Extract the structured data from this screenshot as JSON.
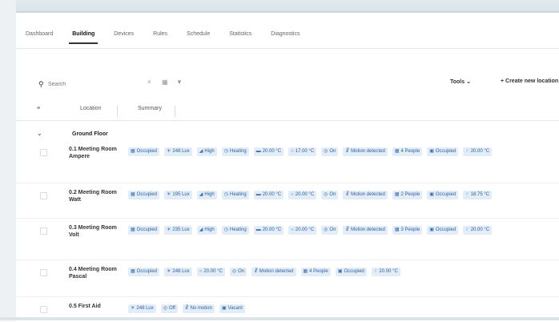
{
  "tabs": [
    "Dashboard",
    "Building",
    "Devices",
    "Rules",
    "Schedule",
    "Statistics",
    "Diagnostics"
  ],
  "active_tab": "Building",
  "toolbar": {
    "search_placeholder": "Search",
    "clear_icon": "close-icon",
    "view_icon": "grid-icon",
    "filter_icon": "filter-icon",
    "tools_label": "Tools ⌄",
    "create_label": "+ Create new location"
  },
  "table": {
    "headers": [
      "Location",
      "Summary"
    ],
    "group_label": "Ground Floor",
    "rows": [
      {
        "name": "0.1 Meeting Room Ampere",
        "chips": [
          {
            "icon": "people-icon",
            "text": "Occupied"
          },
          {
            "icon": "sun-icon",
            "text": "248 Lux"
          },
          {
            "icon": "signal-icon",
            "text": "High"
          },
          {
            "icon": "clock-icon",
            "text": "Heating"
          },
          {
            "icon": "thermo-icon",
            "text": "20.00 °C"
          },
          {
            "icon": "drop-icon",
            "text": "17.00 °C"
          },
          {
            "icon": "power-icon",
            "text": "On"
          },
          {
            "icon": "person-icon",
            "text": "Motion detected"
          },
          {
            "icon": "people-icon",
            "text": "4 People"
          },
          {
            "icon": "door-icon",
            "text": "Occupied"
          },
          {
            "icon": "temp-icon",
            "text": "20.00 °C"
          }
        ]
      },
      {
        "name": "0.2 Meeting Room Watt",
        "chips": [
          {
            "icon": "people-icon",
            "text": "Occupied"
          },
          {
            "icon": "sun-icon",
            "text": "195 Lux"
          },
          {
            "icon": "signal-icon",
            "text": "High"
          },
          {
            "icon": "clock-icon",
            "text": "Heating"
          },
          {
            "icon": "thermo-icon",
            "text": "20.00 °C"
          },
          {
            "icon": "drop-icon",
            "text": "20.00 °C"
          },
          {
            "icon": "power-icon",
            "text": "On"
          },
          {
            "icon": "person-icon",
            "text": "Motion detected"
          },
          {
            "icon": "people-icon",
            "text": "2 People"
          },
          {
            "icon": "door-icon",
            "text": "Occupied"
          },
          {
            "icon": "temp-icon",
            "text": "18.75 °C"
          }
        ]
      },
      {
        "name": "0.3 Meeting Room Volt",
        "chips": [
          {
            "icon": "people-icon",
            "text": "Occupied"
          },
          {
            "icon": "sun-icon",
            "text": "235 Lux"
          },
          {
            "icon": "signal-icon",
            "text": "High"
          },
          {
            "icon": "clock-icon",
            "text": "Heating"
          },
          {
            "icon": "thermo-icon",
            "text": "20.00 °C"
          },
          {
            "icon": "drop-icon",
            "text": "20.00 °C"
          },
          {
            "icon": "power-icon",
            "text": "On"
          },
          {
            "icon": "person-icon",
            "text": "Motion detected"
          },
          {
            "icon": "people-icon",
            "text": "3 People"
          },
          {
            "icon": "door-icon",
            "text": "Occupied"
          },
          {
            "icon": "temp-icon",
            "text": "20.00 °C"
          }
        ]
      },
      {
        "name": "0.4 Meeting Room Pascal",
        "chips": [
          {
            "icon": "people-icon",
            "text": "Occupied"
          },
          {
            "icon": "sun-icon",
            "text": "248 Lux"
          },
          {
            "icon": "drop-icon",
            "text": "20.00 °C"
          },
          {
            "icon": "power-icon",
            "text": "On"
          },
          {
            "icon": "person-icon",
            "text": "Motion detected"
          },
          {
            "icon": "people-icon",
            "text": "4 People"
          },
          {
            "icon": "door-icon",
            "text": "Occupied"
          },
          {
            "icon": "temp-icon",
            "text": "20.00 °C"
          }
        ]
      },
      {
        "name": "0.5 First Aid",
        "chips": [
          {
            "icon": "sun-icon",
            "text": "248 Lux"
          },
          {
            "icon": "power-icon",
            "text": "Off"
          },
          {
            "icon": "person-icon",
            "text": "No motion"
          },
          {
            "icon": "door-icon",
            "text": "Vacant"
          }
        ]
      }
    ]
  },
  "colors": {
    "chip_bg": "#e2edf8",
    "chip_text": "#2f5f9a",
    "active_tab_underline": "#333333"
  }
}
